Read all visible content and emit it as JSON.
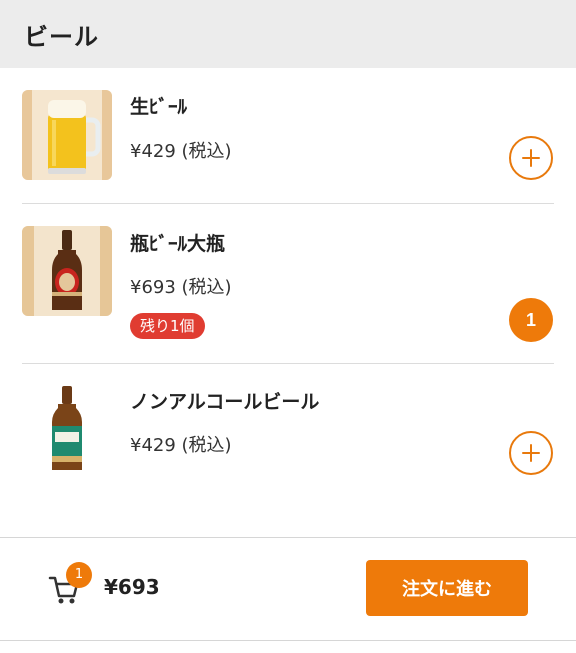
{
  "header": {
    "title": "ビール"
  },
  "items": [
    {
      "name": "生ﾋﾞｰﾙ",
      "price": "¥429 (税込)",
      "badge": "",
      "quantity": "",
      "action_icon": "plus-icon"
    },
    {
      "name": "瓶ﾋﾞｰﾙ大瓶",
      "price": "¥693 (税込)",
      "badge": "残り1個",
      "quantity": "1",
      "action_icon": ""
    },
    {
      "name": "ノンアルコールビール",
      "price": "¥429 (税込)",
      "badge": "",
      "quantity": "",
      "action_icon": "plus-icon"
    }
  ],
  "footer": {
    "cart_icon": "cart-icon",
    "cart_count": "1",
    "total": "¥693",
    "order_button": "注文に進む"
  },
  "colors": {
    "accent": "#ee7a0a",
    "badge_red": "#e03c31",
    "header_bg": "#ececec"
  }
}
